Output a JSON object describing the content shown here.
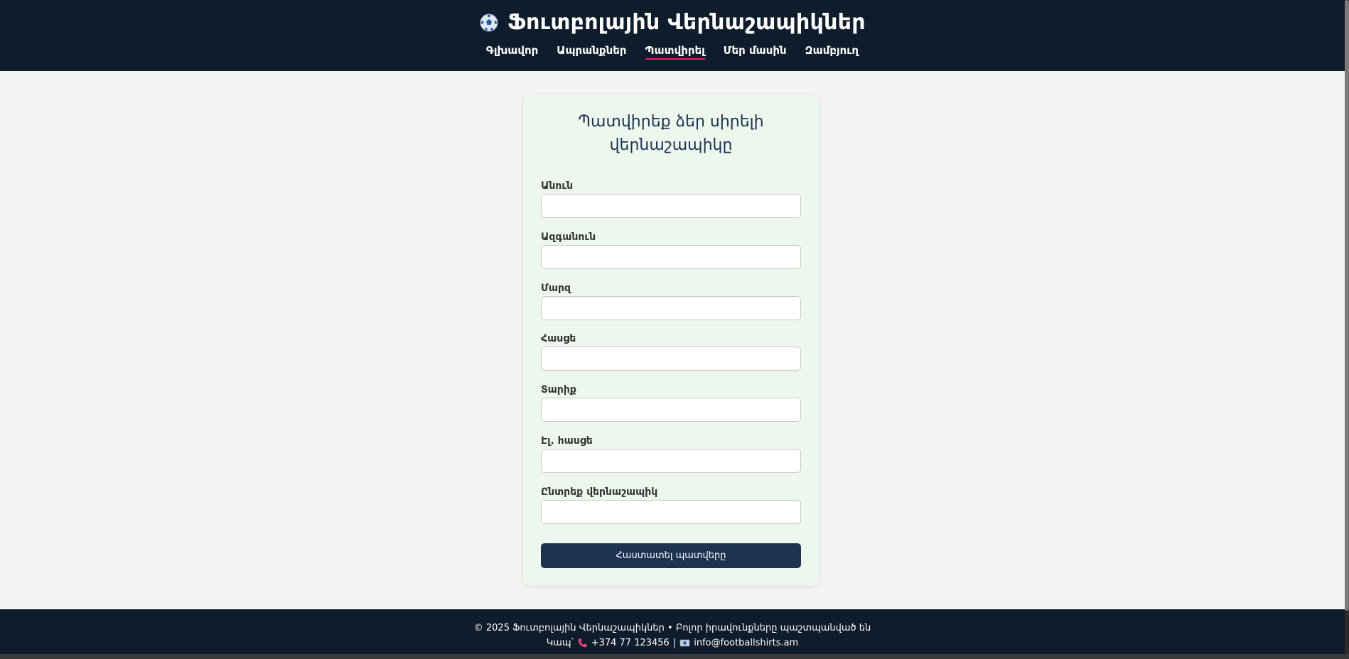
{
  "header": {
    "site_title": "Ֆուտբոլային Վերնաշապիկներ",
    "logo_icon": "soccer-ball-icon",
    "nav": [
      {
        "label": "Գլխավոր",
        "active": false
      },
      {
        "label": "Ապրանքներ",
        "active": false
      },
      {
        "label": "Պատվիրել",
        "active": true
      },
      {
        "label": "Մեր մասին",
        "active": false
      },
      {
        "label": "Զամբյուղ",
        "active": false
      }
    ]
  },
  "form": {
    "title_line1": "Պատվիրեք ձեր սիրելի",
    "title_line2": "վերնաշապիկը",
    "fields": [
      {
        "label": "Անուն",
        "value": "",
        "placeholder": ""
      },
      {
        "label": "Ազգանուն",
        "value": "",
        "placeholder": ""
      },
      {
        "label": "Մարզ",
        "value": "",
        "placeholder": ""
      },
      {
        "label": "Հասցե",
        "value": "",
        "placeholder": ""
      },
      {
        "label": "Տարիք",
        "value": "",
        "placeholder": ""
      },
      {
        "label": "Էլ. հասցե",
        "value": "",
        "placeholder": ""
      },
      {
        "label": "Ընտրեք վերնաշապիկ",
        "value": "",
        "placeholder": ""
      }
    ],
    "submit_label": "Հաստատել պատվերը"
  },
  "footer": {
    "copyright": "© 2025 Ֆուտբոլային Վերնաշապիկներ • Բոլոր իրավունքները պաշտպանված են",
    "contact_prefix": "Կապ՝",
    "phone_icon": "phone-icon",
    "phone": "+374 77 123456",
    "separator": "|",
    "email_icon": "email-icon",
    "email": "info@footballshirts.am"
  },
  "colors": {
    "header_bg": "#0f1c2b",
    "card_bg": "#eef7ee",
    "accent": "#1c3352",
    "active_underline": "#e0245e",
    "page_bg": "#f3f3f3"
  }
}
